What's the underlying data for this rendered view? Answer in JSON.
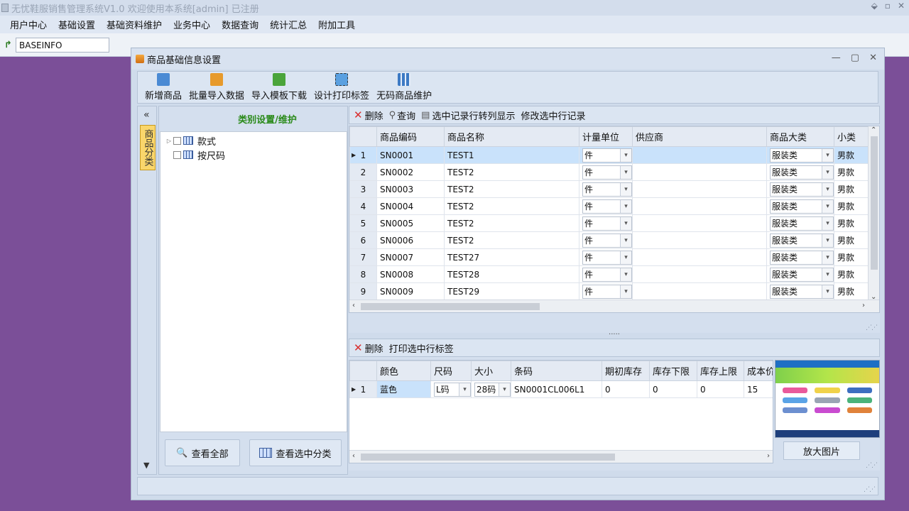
{
  "app": {
    "title": "无忧鞋服销售管理系统V1.0  欢迎使用本系统[admin] 已注册",
    "controls": [
      "⬙",
      "▫",
      "✕"
    ]
  },
  "menu": [
    "用户中心",
    "基础设置",
    "基础资料维护",
    "业务中心",
    "数据查询",
    "统计汇总",
    "附加工具"
  ],
  "path": {
    "value": "BASEINFO"
  },
  "window": {
    "title": "商品基础信息设置",
    "controls": [
      "—",
      "▢",
      "✕"
    ]
  },
  "toolbar": {
    "buttons": [
      {
        "label": "新增商品",
        "color": "#4a8ad4"
      },
      {
        "label": "批量导入数据",
        "color": "#e79a2c"
      },
      {
        "label": "导入模板下载",
        "color": "#4aa43a"
      },
      {
        "label": "设计打印标签",
        "color": "#5aa0e0"
      },
      {
        "label": "无码商品维护",
        "color": "#3d7ac4"
      }
    ]
  },
  "sidebar": {
    "collapse": "«",
    "vtab": "商品分类",
    "down": "▼"
  },
  "tree": {
    "header": "类别设置/维护",
    "nodes": [
      {
        "label": "款式",
        "expandable": true
      },
      {
        "label": "按尺码",
        "expandable": false
      }
    ],
    "view_all": "查看全部",
    "view_selected": "查看选中分类"
  },
  "top_actions": {
    "delete": "删除",
    "query": "查询",
    "transpose": "选中记录行转列显示",
    "edit": "修改选中行记录"
  },
  "products": {
    "columns": [
      "",
      "商品编码",
      "商品名称",
      "计量单位",
      "供应商",
      "商品大类",
      "小类"
    ],
    "rows": [
      {
        "n": "1",
        "code": "SN0001",
        "name": "TEST1",
        "unit": "件",
        "supplier": "",
        "cat": "服装类",
        "sub": "男款"
      },
      {
        "n": "2",
        "code": "SN0002",
        "name": "TEST2",
        "unit": "件",
        "supplier": "",
        "cat": "服装类",
        "sub": "男款"
      },
      {
        "n": "3",
        "code": "SN0003",
        "name": "TEST2",
        "unit": "件",
        "supplier": "",
        "cat": "服装类",
        "sub": "男款"
      },
      {
        "n": "4",
        "code": "SN0004",
        "name": "TEST2",
        "unit": "件",
        "supplier": "",
        "cat": "服装类",
        "sub": "男款"
      },
      {
        "n": "5",
        "code": "SN0005",
        "name": "TEST2",
        "unit": "件",
        "supplier": "",
        "cat": "服装类",
        "sub": "男款"
      },
      {
        "n": "6",
        "code": "SN0006",
        "name": "TEST2",
        "unit": "件",
        "supplier": "",
        "cat": "服装类",
        "sub": "男款"
      },
      {
        "n": "7",
        "code": "SN0007",
        "name": "TEST27",
        "unit": "件",
        "supplier": "",
        "cat": "服装类",
        "sub": "男款"
      },
      {
        "n": "8",
        "code": "SN0008",
        "name": "TEST28",
        "unit": "件",
        "supplier": "",
        "cat": "服装类",
        "sub": "男款"
      },
      {
        "n": "9",
        "code": "SN0009",
        "name": "TEST29",
        "unit": "件",
        "supplier": "",
        "cat": "服装类",
        "sub": "男款"
      }
    ]
  },
  "bottom_actions": {
    "delete": "删除",
    "print": "打印选中行标签"
  },
  "variants": {
    "columns": [
      "",
      "颜色",
      "尺码",
      "大小",
      "条码",
      "期初库存",
      "库存下限",
      "库存上限",
      "成本价"
    ],
    "rows": [
      {
        "n": "1",
        "color": "蓝色",
        "size": "L码",
        "dim": "28码",
        "barcode": "SN0001CL006L1",
        "init": "0",
        "low": "0",
        "high": "0",
        "cost": "15"
      }
    ]
  },
  "zoom_button": "放大图片",
  "splitter": "....."
}
